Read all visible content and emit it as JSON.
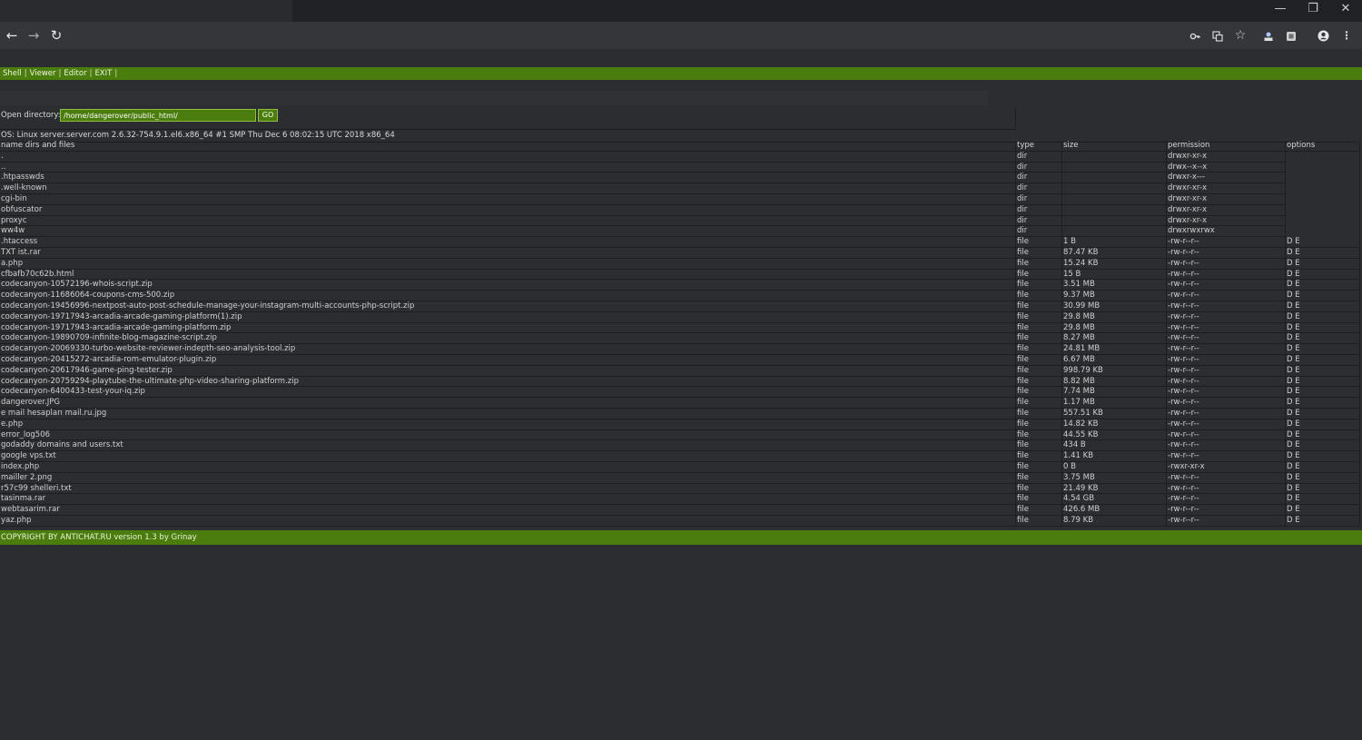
{
  "browser": {
    "window_controls": {
      "minimize": "—",
      "maximize": "❐",
      "close": "✕"
    },
    "nav": {
      "back": "←",
      "forward": "→",
      "reload": "↻"
    },
    "toolbar_icons": [
      "key-icon",
      "translate-icon",
      "star-icon",
      "extension-icon",
      "extension-icon",
      "profile-icon",
      "menu-icon"
    ]
  },
  "shell": {
    "menu": [
      "Shell",
      "Viewer",
      "Editor",
      "EXIT"
    ],
    "menu_separator": "|",
    "open_directory_label": "Open directory:",
    "directory_value": "/home/dangerover/public_html/",
    "go_label": "GO",
    "os_info": "OS: Linux server.server.com 2.6.32-754.9.1.el6.x86_64 #1 SMP Thu Dec 6 08:02:15 UTC 2018 x86_64",
    "columns": {
      "name": "name dirs and files",
      "type": "type",
      "size": "size",
      "permission": "permission",
      "options": "options"
    },
    "dirs": [
      {
        "name": ".",
        "type": "dir",
        "perm": "drwxr-xr-x"
      },
      {
        "name": "..",
        "type": "dir",
        "perm": "drwx--x--x"
      },
      {
        "name": ".htpasswds",
        "type": "dir",
        "perm": "drwxr-x---"
      },
      {
        "name": ".well-known",
        "type": "dir",
        "perm": "drwxr-xr-x"
      },
      {
        "name": "cgi-bin",
        "type": "dir",
        "perm": "drwxr-xr-x"
      },
      {
        "name": "obfuscator",
        "type": "dir",
        "perm": "drwxr-xr-x"
      },
      {
        "name": "proxyc",
        "type": "dir",
        "perm": "drwxr-xr-x"
      },
      {
        "name": "ww4w",
        "type": "dir",
        "perm": "drwxrwxrwx"
      }
    ],
    "files": [
      {
        "name": ".htaccess",
        "type": "file",
        "size": "1 B",
        "perm": "-rw-r--r--"
      },
      {
        "name": "TXT ist.rar",
        "type": "file",
        "size": "87.47 KB",
        "perm": "-rw-r--r--"
      },
      {
        "name": "a.php",
        "type": "file",
        "size": "15.24 KB",
        "perm": "-rw-r--r--"
      },
      {
        "name": "cfbafb70c62b.html",
        "type": "file",
        "size": "15 B",
        "perm": "-rw-r--r--"
      },
      {
        "name": "codecanyon-10572196-whois-script.zip",
        "type": "file",
        "size": "3.51 MB",
        "perm": "-rw-r--r--"
      },
      {
        "name": "codecanyon-11686064-coupons-cms-500.zip",
        "type": "file",
        "size": "9.37 MB",
        "perm": "-rw-r--r--"
      },
      {
        "name": "codecanyon-19456996-nextpost-auto-post-schedule-manage-your-instagram-multi-accounts-php-script.zip",
        "type": "file",
        "size": "30.99 MB",
        "perm": "-rw-r--r--"
      },
      {
        "name": "codecanyon-19717943-arcadia-arcade-gaming-platform(1).zip",
        "type": "file",
        "size": "29.8 MB",
        "perm": "-rw-r--r--"
      },
      {
        "name": "codecanyon-19717943-arcadia-arcade-gaming-platform.zip",
        "type": "file",
        "size": "29.8 MB",
        "perm": "-rw-r--r--"
      },
      {
        "name": "codecanyon-19890709-infinite-blog-magazine-script.zip",
        "type": "file",
        "size": "8.27 MB",
        "perm": "-rw-r--r--"
      },
      {
        "name": "codecanyon-20069330-turbo-website-reviewer-indepth-seo-analysis-tool.zip",
        "type": "file",
        "size": "24.81 MB",
        "perm": "-rw-r--r--"
      },
      {
        "name": "codecanyon-20415272-arcadia-rom-emulator-plugin.zip",
        "type": "file",
        "size": "6.67 MB",
        "perm": "-rw-r--r--"
      },
      {
        "name": "codecanyon-20617946-game-ping-tester.zip",
        "type": "file",
        "size": "998.79 KB",
        "perm": "-rw-r--r--"
      },
      {
        "name": "codecanyon-20759294-playtube-the-ultimate-php-video-sharing-platform.zip",
        "type": "file",
        "size": "8.82 MB",
        "perm": "-rw-r--r--"
      },
      {
        "name": "codecanyon-6400433-test-your-iq.zip",
        "type": "file",
        "size": "7.74 MB",
        "perm": "-rw-r--r--"
      },
      {
        "name": "dangerover.JPG",
        "type": "file",
        "size": "1.17 MB",
        "perm": "-rw-r--r--"
      },
      {
        "name": "e mail hesapları mail.ru.jpg",
        "type": "file",
        "size": "557.51 KB",
        "perm": "-rw-r--r--"
      },
      {
        "name": "e.php",
        "type": "file",
        "size": "14.82 KB",
        "perm": "-rw-r--r--"
      },
      {
        "name": "error_log506",
        "type": "file",
        "size": "44.55 KB",
        "perm": "-rw-r--r--"
      },
      {
        "name": "godaddy domains and users.txt",
        "type": "file",
        "size": "434 B",
        "perm": "-rw-r--r--"
      },
      {
        "name": "google vps.txt",
        "type": "file",
        "size": "1.41 KB",
        "perm": "-rw-r--r--"
      },
      {
        "name": "index.php",
        "type": "file",
        "size": "0 B",
        "perm": "-rwxr-xr-x"
      },
      {
        "name": "mailler 2.png",
        "type": "file",
        "size": "3.75 MB",
        "perm": "-rw-r--r--"
      },
      {
        "name": "r57c99 shelleri.txt",
        "type": "file",
        "size": "21.49 KB",
        "perm": "-rw-r--r--"
      },
      {
        "name": "tasinma.rar",
        "type": "file",
        "size": "4.54 GB",
        "perm": "-rw-r--r--"
      },
      {
        "name": "webtasarim.rar",
        "type": "file",
        "size": "426.6 MB",
        "perm": "-rw-r--r--"
      },
      {
        "name": "yaz.php",
        "type": "file",
        "size": "8.79 KB",
        "perm": "-rw-r--r--"
      }
    ],
    "file_options": "D E",
    "footer": "COPYRIGHT BY ANTICHAT.RU version 1.3 by Grinay"
  }
}
